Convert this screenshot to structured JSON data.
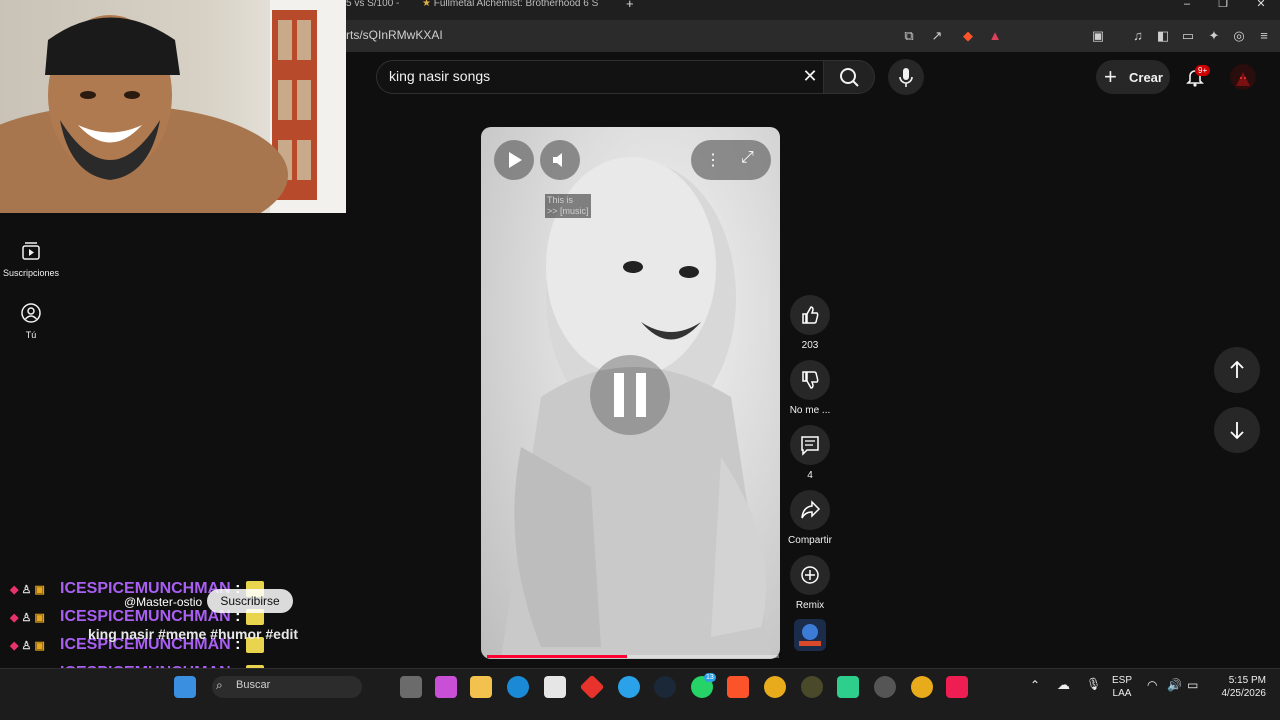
{
  "browser": {
    "tabs": [
      {
        "label": "5 vs S/100 -"
      },
      {
        "label": "Fullmetal Alchemist: Brotherhood 6 S"
      }
    ],
    "new_tab_label": "+",
    "url": "rts/sQInRMwKXAI"
  },
  "header": {
    "search_query": "king nasir songs",
    "create_label": "Crear",
    "notifications_badge": "9+"
  },
  "sidebar": {
    "items": [
      {
        "label": "Suscripciones",
        "icon": "subscriptions-icon"
      },
      {
        "label": "Tú",
        "icon": "you-icon"
      }
    ]
  },
  "video": {
    "caption_lines": [
      "This is",
      ">> [music]"
    ],
    "progress_fraction": 0.48,
    "state": "paused"
  },
  "actions": {
    "like_count": "203",
    "dislike_label": "No me ...",
    "comment_count": "4",
    "share_label": "Compartir",
    "remix_label": "Remix"
  },
  "overlay": {
    "chat_user": "ICESPICEMUNCHMAN",
    "chat_colon": ":",
    "chat_repeat": 5,
    "channel_handle": "@Master-ostio",
    "subscribe_label": "Suscribirse",
    "video_title": "king nasir #meme #humor #edit"
  },
  "taskbar": {
    "search_placeholder": "Buscar",
    "whatsapp_badge": "13",
    "lang_line1": "ESP",
    "lang_line2": "LAA",
    "time": "5:15 PM",
    "date": "4/25/2026"
  },
  "colors": {
    "background": "#0f0f0f",
    "accent_red": "#ff0033",
    "chat_name": "#a95ff2"
  }
}
